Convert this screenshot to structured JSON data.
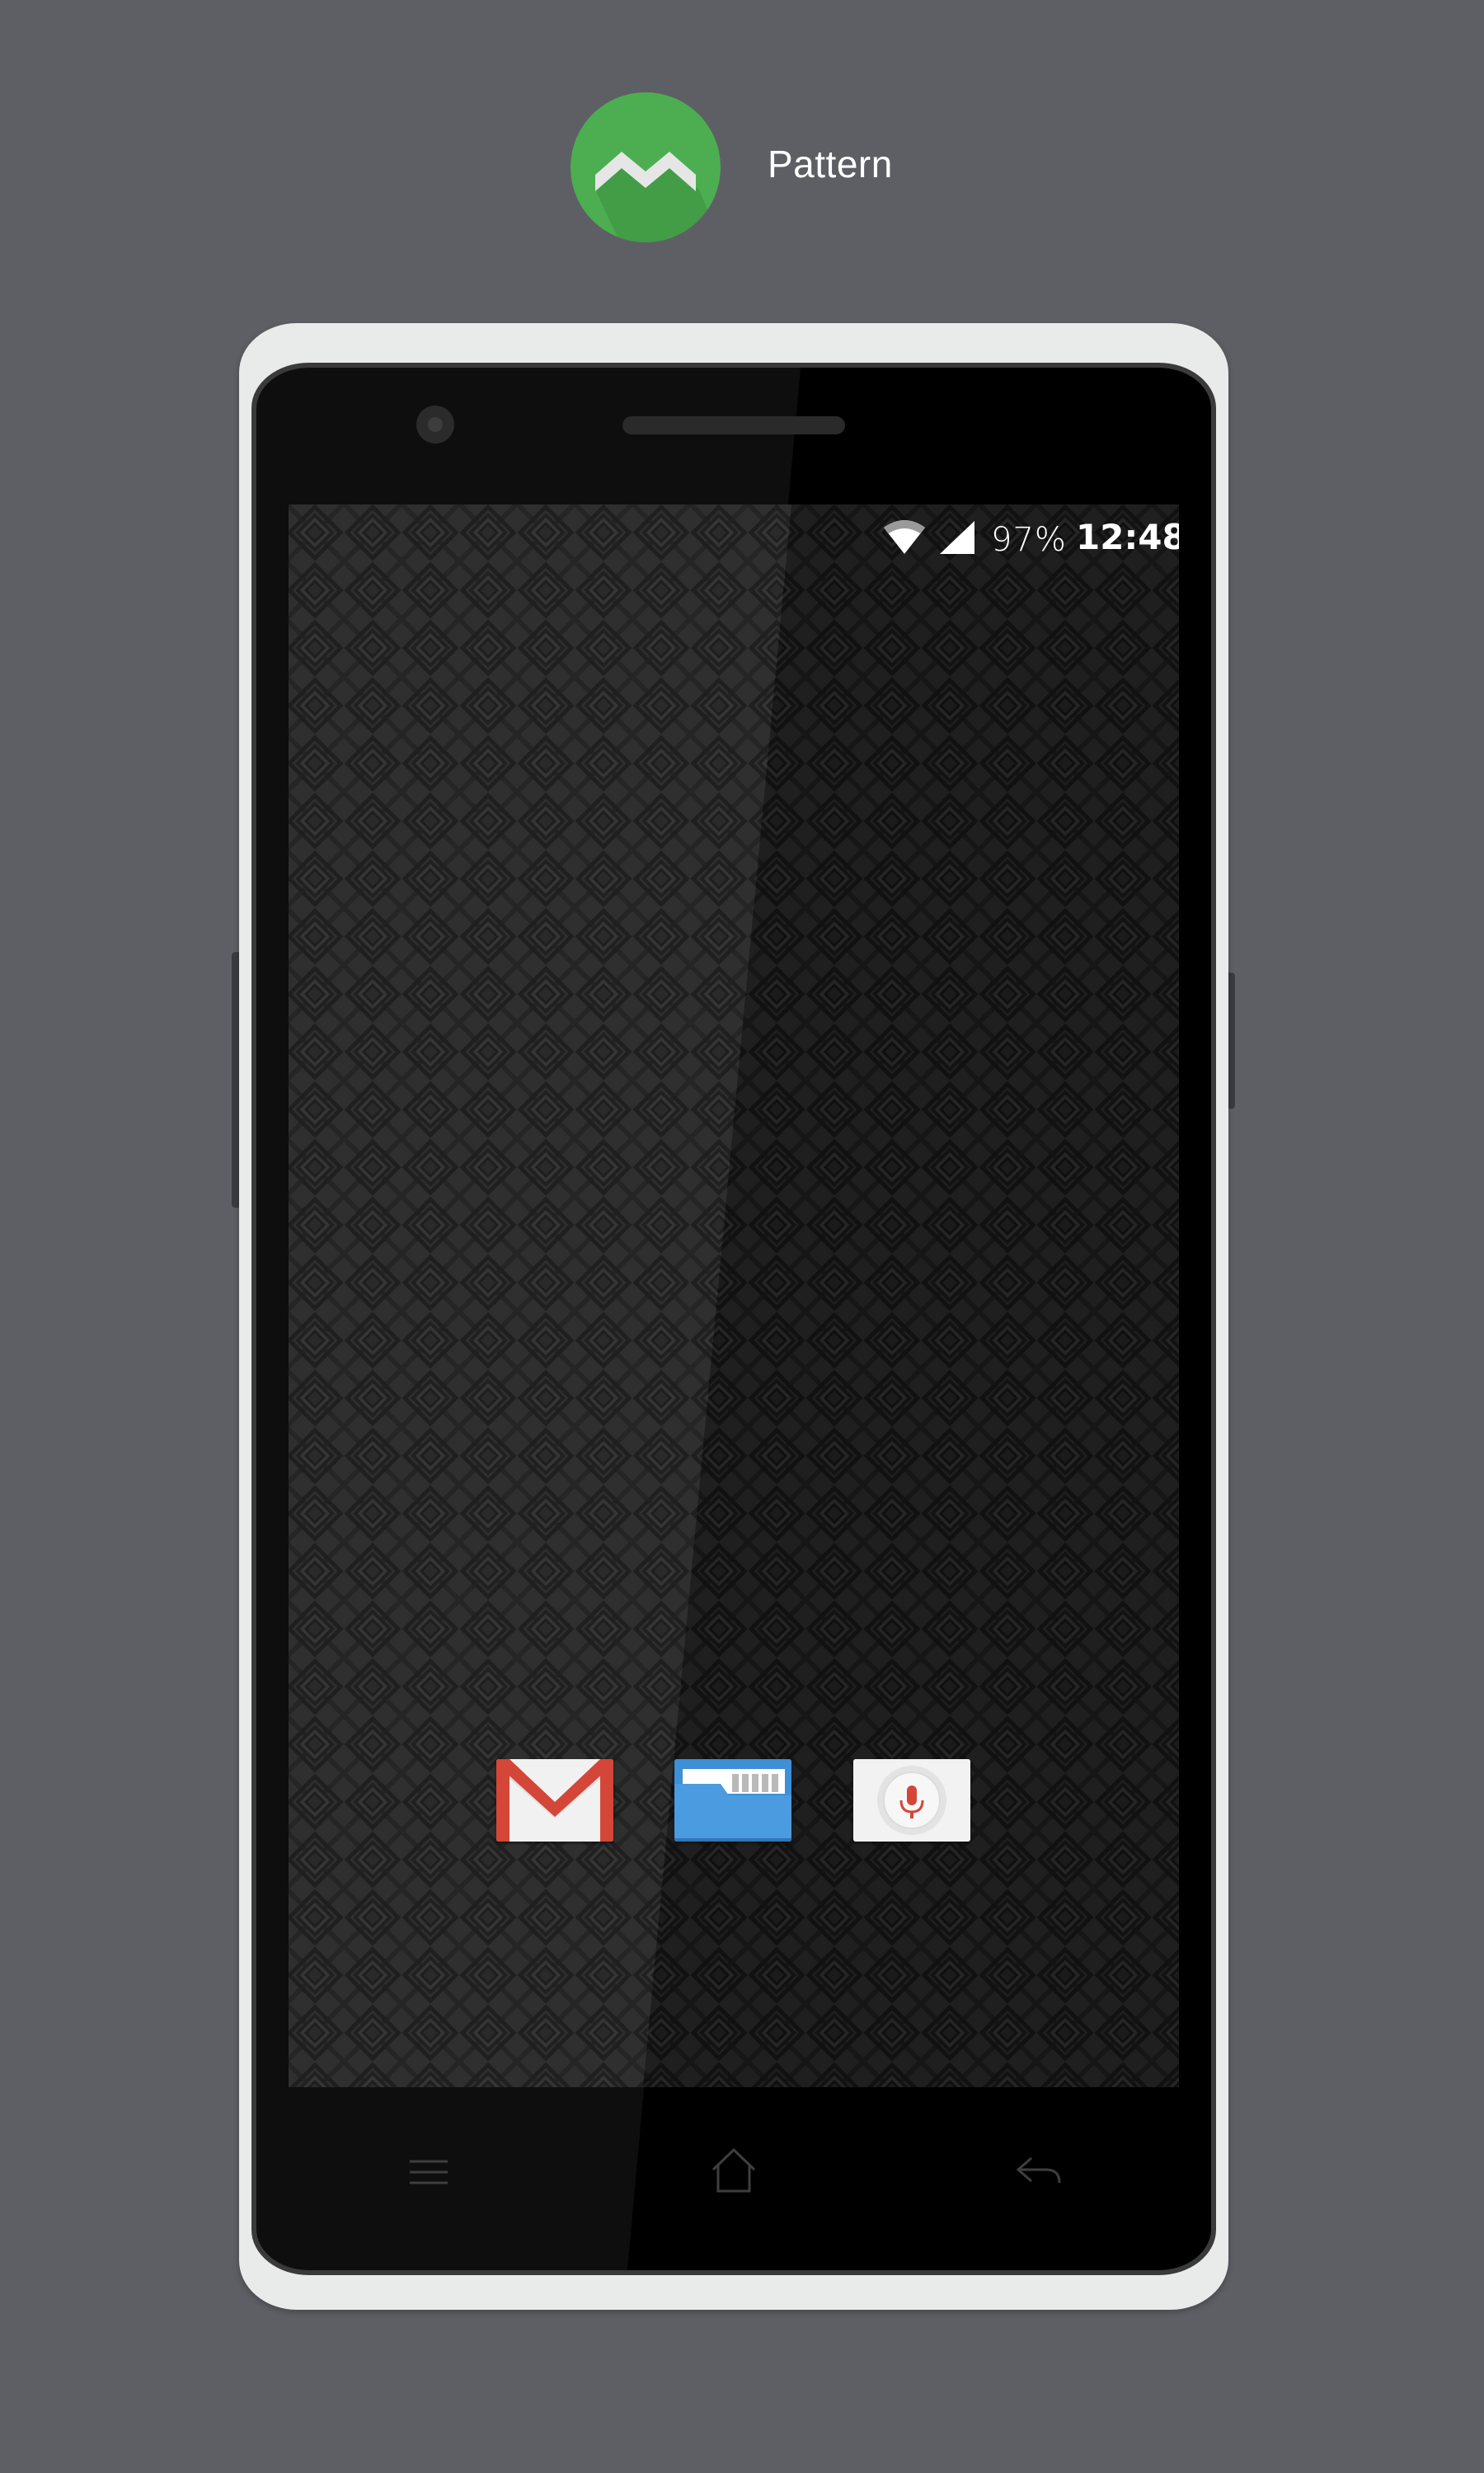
{
  "header": {
    "app_name": "Pattern",
    "logo_icon": "pattern-logo-icon",
    "logo_color": "#4cae50"
  },
  "status_bar": {
    "wifi_icon": "wifi-icon",
    "signal_icon": "cell-signal-icon",
    "battery": "97%",
    "time": "12:48"
  },
  "dock": {
    "apps": [
      {
        "icon": "gmail-icon",
        "color": "#d44638"
      },
      {
        "icon": "file-manager-icon",
        "color": "#3d8fd6"
      },
      {
        "icon": "voice-search-icon",
        "color": "#d44638"
      }
    ]
  },
  "nav_keys": {
    "menu": "menu-icon",
    "home": "home-icon",
    "back": "back-icon"
  },
  "colors": {
    "background": "#5e5f64",
    "phone_shell": "#e9eaea",
    "wallpaper": "#1c1c1c"
  }
}
